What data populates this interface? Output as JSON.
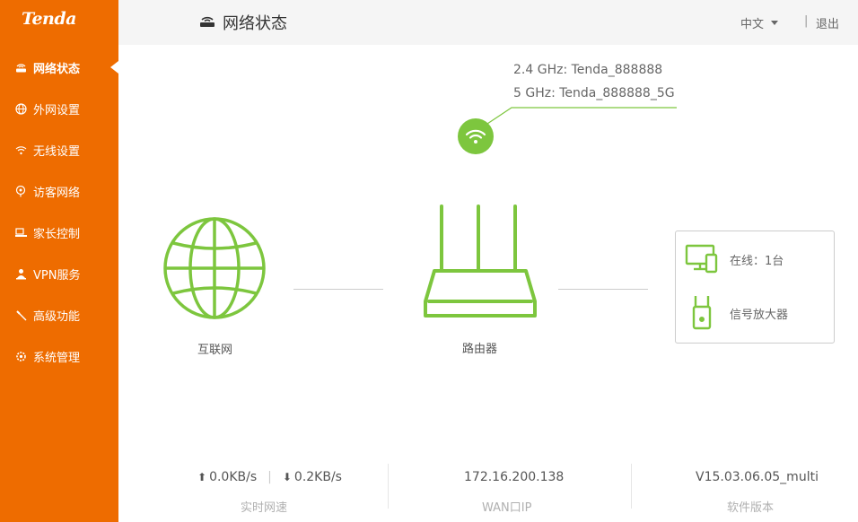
{
  "brand": {
    "logo_text": "Tenda",
    "accent": "#ee6c00",
    "status_green": "#7dc63e"
  },
  "sidebar": {
    "items": [
      {
        "label": "网络状态",
        "icon": "router-icon",
        "active": true
      },
      {
        "label": "外网设置",
        "icon": "globe-icon",
        "active": false
      },
      {
        "label": "无线设置",
        "icon": "wifi-icon",
        "active": false
      },
      {
        "label": "访客网络",
        "icon": "guest-icon",
        "active": false
      },
      {
        "label": "家长控制",
        "icon": "parental-control-icon",
        "active": false
      },
      {
        "label": "VPN服务",
        "icon": "vpn-icon",
        "active": false
      },
      {
        "label": "高级功能",
        "icon": "wrench-icon",
        "active": false
      },
      {
        "label": "系统管理",
        "icon": "gear-icon",
        "active": false
      }
    ]
  },
  "header": {
    "title": "网络状态",
    "language": "中文",
    "separator": "|",
    "logout": "退出"
  },
  "wireless": {
    "ssid_24": "2.4 GHz: Tenda_888888",
    "ssid_5": "5 GHz: Tenda_888888_5G"
  },
  "topology": {
    "internet_label": "互联网",
    "router_label": "路由器",
    "clients_online": "在线：1台",
    "extender_label": "信号放大器"
  },
  "stats": {
    "upload": "0.0KB/s",
    "download": "0.2KB/s",
    "speed_label": "实时网速",
    "wan_ip": "172.16.200.138",
    "wan_ip_label": "WAN口IP",
    "firmware": "V15.03.06.05_multi",
    "firmware_label": "软件版本"
  }
}
